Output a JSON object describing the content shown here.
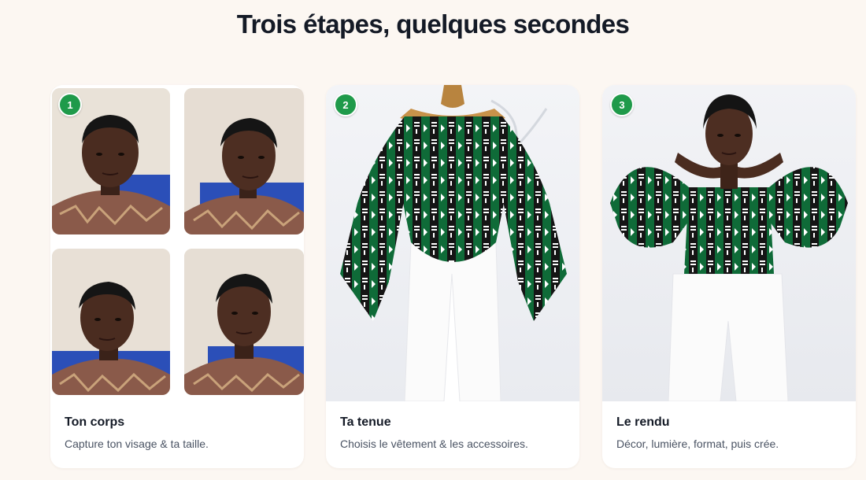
{
  "section": {
    "title": "Trois étapes, quelques secondes"
  },
  "steps": [
    {
      "number": "1",
      "title": "Ton corps",
      "description": "Capture ton visage & ta taille."
    },
    {
      "number": "2",
      "title": "Ta tenue",
      "description": "Choisis le vêtement & les accessoires."
    },
    {
      "number": "3",
      "title": "Le rendu",
      "description": "Décor, lumière, format, puis crée."
    }
  ],
  "colors": {
    "badge": "#1f9a4a",
    "background": "#fcf7f2",
    "garment_green": "#0f6b38"
  }
}
